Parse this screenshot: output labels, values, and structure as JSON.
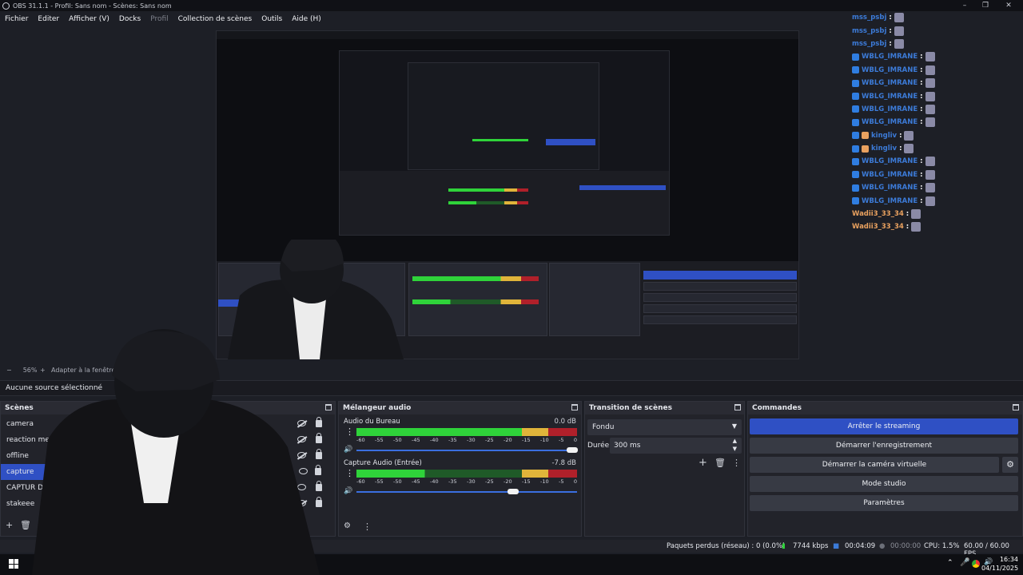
{
  "window": {
    "title": "OBS 31.1.1 - Profil: Sans nom - Scènes: Sans nom"
  },
  "menu": [
    {
      "label": "Fichier",
      "enabled": true
    },
    {
      "label": "Editer",
      "enabled": true
    },
    {
      "label": "Afficher (V)",
      "enabled": true
    },
    {
      "label": "Docks",
      "enabled": true
    },
    {
      "label": "Profil",
      "enabled": false
    },
    {
      "label": "Collection de scènes",
      "enabled": true
    },
    {
      "label": "Outils",
      "enabled": true
    },
    {
      "label": "Aide (H)",
      "enabled": true
    }
  ],
  "chat": [
    {
      "user": "mss_psbj",
      "color": "#3c7bd8",
      "badges": 0
    },
    {
      "user": "mss_psbj",
      "color": "#3c7bd8",
      "badges": 0
    },
    {
      "user": "mss_psbj",
      "color": "#3c7bd8",
      "badges": 0
    },
    {
      "user": "WBLG_IMRANE",
      "color": "#3c7bd8",
      "badges": 1
    },
    {
      "user": "WBLG_IMRANE",
      "color": "#3c7bd8",
      "badges": 1
    },
    {
      "user": "WBLG_IMRANE",
      "color": "#3c7bd8",
      "badges": 1
    },
    {
      "user": "WBLG_IMRANE",
      "color": "#3c7bd8",
      "badges": 1
    },
    {
      "user": "WBLG_IMRANE",
      "color": "#3c7bd8",
      "badges": 1
    },
    {
      "user": "WBLG_IMRANE",
      "color": "#3c7bd8",
      "badges": 1
    },
    {
      "user": "kingliv",
      "color": "#3c7bd8",
      "badges": 2
    },
    {
      "user": "kingliv",
      "color": "#3c7bd8",
      "badges": 2
    },
    {
      "user": "WBLG_IMRANE",
      "color": "#3c7bd8",
      "badges": 1
    },
    {
      "user": "WBLG_IMRANE",
      "color": "#3c7bd8",
      "badges": 1
    },
    {
      "user": "WBLG_IMRANE",
      "color": "#3c7bd8",
      "badges": 1
    },
    {
      "user": "WBLG_IMRANE",
      "color": "#3c7bd8",
      "badges": 1
    },
    {
      "user": "Wadii3_33_34",
      "color": "#e9a15f",
      "badges": 0
    },
    {
      "user": "Wadii3_33_34",
      "color": "#e9a15f",
      "badges": 0
    }
  ],
  "zoom": {
    "minus": "−",
    "value": "56%",
    "plus": "+",
    "fit": "Adapter à la fenêtre"
  },
  "nosource": "Aucune source sélectionné",
  "scenes": {
    "title": "Scènes",
    "items": [
      {
        "name": "camera",
        "visible": false,
        "selected": false
      },
      {
        "name": "reaction memes",
        "visible": false,
        "selected": false
      },
      {
        "name": "offline",
        "visible": false,
        "selected": false
      },
      {
        "name": "capture",
        "visible": true,
        "selected": true
      },
      {
        "name": "CAPTUR DE JE",
        "visible": true,
        "selected": false
      },
      {
        "name": "stakeee",
        "visible": false,
        "selected": false
      }
    ]
  },
  "mixer": {
    "title": "Mélangeur audio",
    "ticks": [
      "-60",
      "-55",
      "-50",
      "-45",
      "-40",
      "-35",
      "-30",
      "-25",
      "-20",
      "-15",
      "-10",
      "-5",
      "0"
    ],
    "channels": [
      {
        "name": "Audio du Bureau",
        "db": "0.0 dB",
        "level": 0.77,
        "volume": 0.98
      },
      {
        "name": "Capture Audio (Entrée)",
        "db": "-7.8 dB",
        "level": 0.31,
        "volume": 0.71
      }
    ]
  },
  "transitions": {
    "title": "Transition de scènes",
    "selected": "Fondu",
    "duration_label": "Durée",
    "duration": "300 ms"
  },
  "commands": {
    "title": "Commandes",
    "buttons": [
      "Arrêter le streaming",
      "Démarrer l'enregistrement",
      "Démarrer la caméra virtuelle",
      "Mode studio",
      "Paramètres"
    ]
  },
  "status": {
    "dropped": "Paquets perdus (réseau) : 0 (0.0%)",
    "bitrate": "7744 kbps",
    "stream_time": "00:04:09",
    "rec_time": "00:00:00",
    "cpu": "CPU: 1.5%",
    "fps": "60.00 / 60.00 FPS"
  },
  "taskbar": {
    "time": "16:34",
    "date": "04/11/2025"
  },
  "colors": {
    "accent": "#2f50c4",
    "green": "#2fd33a",
    "yellow": "#e0b43a",
    "red": "#b0202a"
  }
}
